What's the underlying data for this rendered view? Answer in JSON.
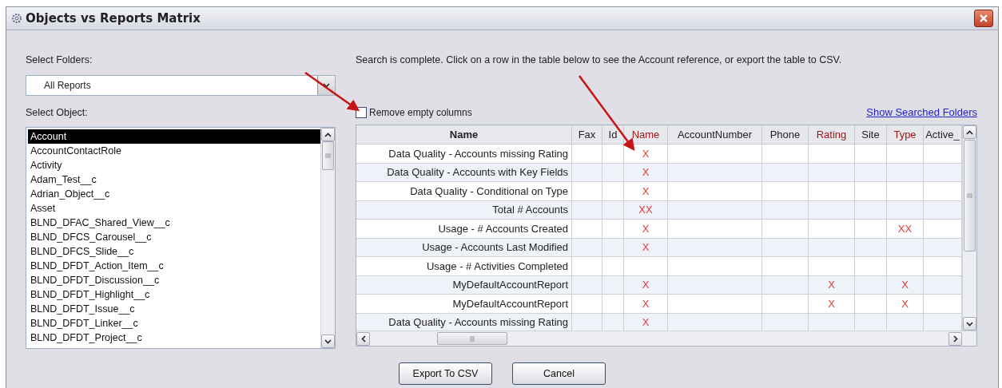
{
  "window": {
    "title": "Objects vs Reports Matrix"
  },
  "folders": {
    "label": "Select Folders:",
    "value": "All Reports"
  },
  "objects": {
    "label": "Select Object:",
    "items": [
      {
        "label": "Account",
        "selected": true
      },
      {
        "label": "AccountContactRole",
        "selected": false
      },
      {
        "label": "Activity",
        "selected": false
      },
      {
        "label": "Adam_Test__c",
        "selected": false
      },
      {
        "label": "Adrian_Object__c",
        "selected": false
      },
      {
        "label": "Asset",
        "selected": false
      },
      {
        "label": "BLND_DFAC_Shared_View__c",
        "selected": false
      },
      {
        "label": "BLND_DFCS_Carousel__c",
        "selected": false
      },
      {
        "label": "BLND_DFCS_Slide__c",
        "selected": false
      },
      {
        "label": "BLND_DFDT_Action_Item__c",
        "selected": false
      },
      {
        "label": "BLND_DFDT_Discussion__c",
        "selected": false
      },
      {
        "label": "BLND_DFDT_Highlight__c",
        "selected": false
      },
      {
        "label": "BLND_DFDT_Issue__c",
        "selected": false
      },
      {
        "label": "BLND_DFDT_Linker__c",
        "selected": false
      },
      {
        "label": "BLND_DFDT_Project__c",
        "selected": false
      }
    ]
  },
  "status": "Search is complete. Click on a row in the table below to see the Account reference, or export the table to CSV.",
  "remove_empty": {
    "label": "Remove empty columns",
    "checked": false
  },
  "show_folders_link": "Show Searched Folders",
  "table": {
    "columns": [
      {
        "label": "Name",
        "highlighted": false
      },
      {
        "label": "Fax",
        "highlighted": false
      },
      {
        "label": "Id",
        "highlighted": false
      },
      {
        "label": "Name",
        "highlighted": true
      },
      {
        "label": "AccountNumber",
        "highlighted": false
      },
      {
        "label": "Phone",
        "highlighted": false
      },
      {
        "label": "Rating",
        "highlighted": true
      },
      {
        "label": "Site",
        "highlighted": false
      },
      {
        "label": "Type",
        "highlighted": true
      },
      {
        "label": "Active_",
        "highlighted": false
      }
    ],
    "rows": [
      [
        "Data Quality - Accounts missing Rating",
        null,
        null,
        "X",
        null,
        null,
        null,
        null,
        null,
        null
      ],
      [
        "Data Quality - Accounts with Key Fields",
        null,
        null,
        "X",
        null,
        null,
        null,
        null,
        null,
        null
      ],
      [
        "Data Quality - Conditional on Type",
        null,
        null,
        "X",
        null,
        null,
        null,
        null,
        null,
        null
      ],
      [
        "Total # Accounts",
        null,
        null,
        "XX",
        null,
        null,
        null,
        null,
        null,
        null
      ],
      [
        "Usage - # Accounts Created",
        null,
        null,
        "X",
        null,
        null,
        null,
        null,
        "XX",
        null
      ],
      [
        "Usage - Accounts Last Modified",
        null,
        null,
        "X",
        null,
        null,
        null,
        null,
        null,
        null
      ],
      [
        "Usage - # Activities Completed",
        null,
        null,
        null,
        null,
        null,
        null,
        null,
        null,
        null
      ],
      [
        "MyDefaultAccountReport",
        null,
        null,
        "X",
        null,
        null,
        "X",
        null,
        "X",
        null
      ],
      [
        "MyDefaultAccountReport",
        null,
        null,
        "X",
        null,
        null,
        "X",
        null,
        "X",
        null
      ],
      [
        "Data Quality - Accounts missing Rating",
        null,
        null,
        "X",
        null,
        null,
        null,
        null,
        null,
        null
      ]
    ]
  },
  "buttons": [
    "Export To CSV",
    "Cancel"
  ]
}
